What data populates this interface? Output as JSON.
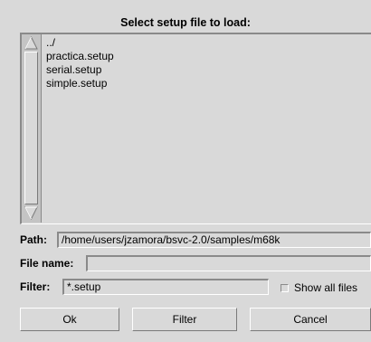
{
  "dialog": {
    "title": "Select setup file to load:"
  },
  "file_list": {
    "items": [
      "../",
      "practica.setup",
      "serial.setup",
      "simple.setup"
    ]
  },
  "path": {
    "label": "Path:",
    "value": "/home/users/jzamora/bsvc-2.0/samples/m68k"
  },
  "file_name": {
    "label": "File name:",
    "value": ""
  },
  "filter": {
    "label": "Filter:",
    "value": "*.setup"
  },
  "show_all_files": {
    "label": "Show all files",
    "checked": false
  },
  "buttons": {
    "ok": "Ok",
    "filter": "Filter",
    "cancel": "Cancel"
  },
  "icons": {
    "scroll_up": "arrow-up-icon",
    "scroll_down": "arrow-down-icon"
  }
}
